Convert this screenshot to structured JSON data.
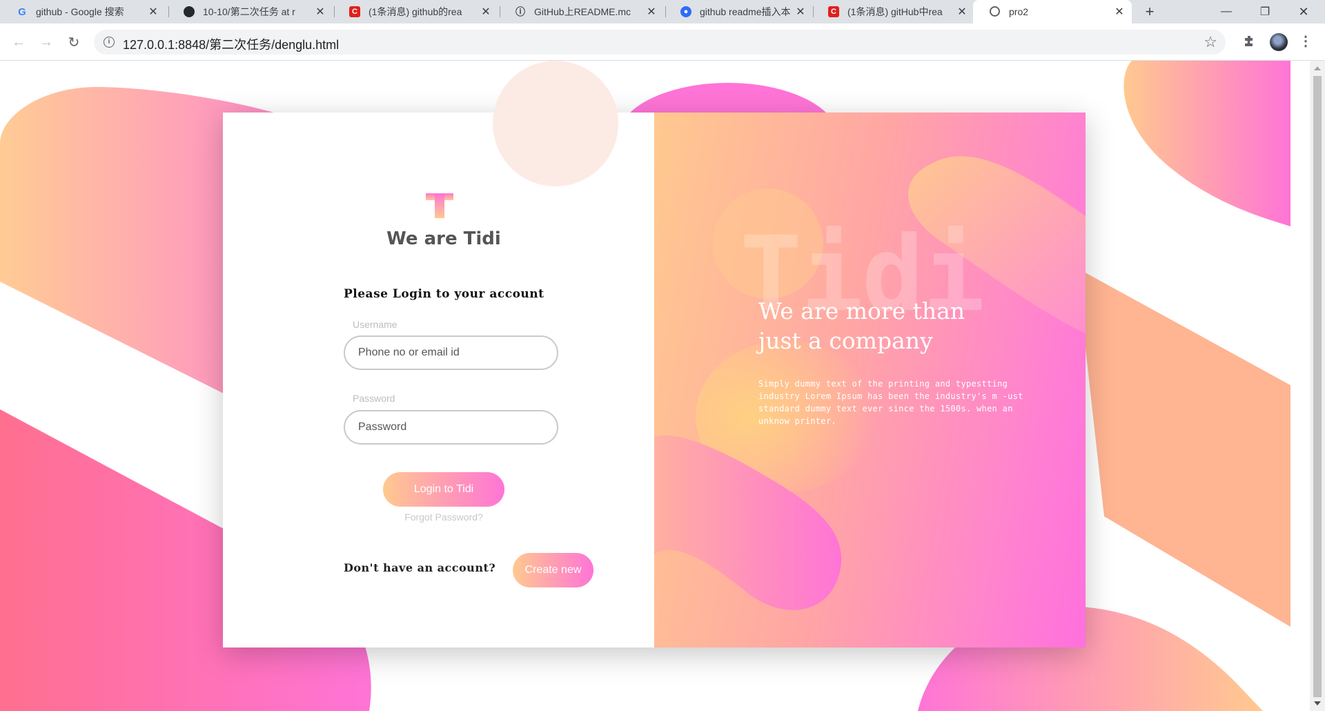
{
  "browser": {
    "tabs": [
      {
        "title": "github - Google 搜索",
        "favicon": "google-icon"
      },
      {
        "title": "10-10/第二次任务 at r",
        "favicon": "github-icon"
      },
      {
        "title": "(1条消息) github的rea",
        "favicon": "csdn-icon"
      },
      {
        "title": "GitHub上README.mc",
        "favicon": "markdown-icon"
      },
      {
        "title": "github readme插入本",
        "favicon": "baidu-icon"
      },
      {
        "title": "(1条消息) gitHub中rea",
        "favicon": "csdn-icon"
      },
      {
        "title": "pro2",
        "favicon": "globe-icon",
        "active": true
      }
    ],
    "url": "127.0.0.1:8848/第二次任务/denglu.html"
  },
  "page": {
    "brand_title": "We are Tidi",
    "login_heading": "Please Login to your account",
    "username_label": "Username",
    "username_placeholder": "Phone no or email id",
    "password_label": "Password",
    "password_placeholder": "Password",
    "login_button": "Login to Tidi",
    "forgot_link": "Forgot Password?",
    "no_account": "Don't have an account?",
    "create_button": "Create new",
    "watermark": "Tidi",
    "tagline_line1": "We are more than",
    "tagline_line2": "just a company",
    "blurb": "Simply dummy text of the printing and typestting industry Lorem Ipsum has been the industry's m -ust standard dummy text ever since the 1500s. when an unknow printer."
  },
  "colors": {
    "gradient_start": "#ffc98f",
    "gradient_end": "#ff74d6",
    "peach_circle": "#fcebe4"
  }
}
